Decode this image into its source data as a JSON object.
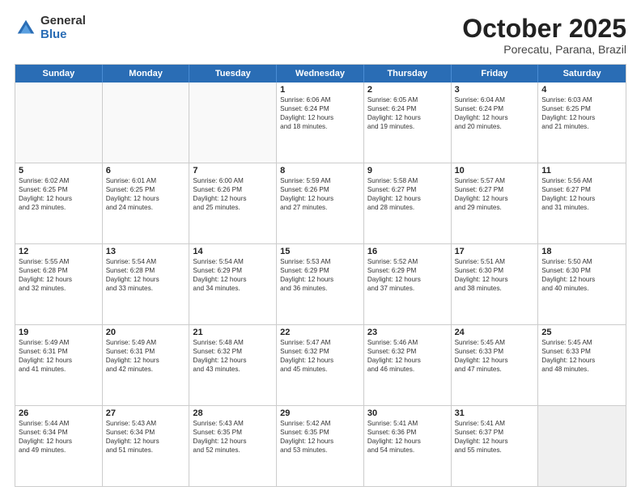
{
  "logo": {
    "general": "General",
    "blue": "Blue"
  },
  "header": {
    "month": "October 2025",
    "location": "Porecatu, Parana, Brazil"
  },
  "weekdays": [
    "Sunday",
    "Monday",
    "Tuesday",
    "Wednesday",
    "Thursday",
    "Friday",
    "Saturday"
  ],
  "rows": [
    [
      {
        "day": "",
        "text": "",
        "empty": true
      },
      {
        "day": "",
        "text": "",
        "empty": true
      },
      {
        "day": "",
        "text": "",
        "empty": true
      },
      {
        "day": "1",
        "text": "Sunrise: 6:06 AM\nSunset: 6:24 PM\nDaylight: 12 hours\nand 18 minutes."
      },
      {
        "day": "2",
        "text": "Sunrise: 6:05 AM\nSunset: 6:24 PM\nDaylight: 12 hours\nand 19 minutes."
      },
      {
        "day": "3",
        "text": "Sunrise: 6:04 AM\nSunset: 6:24 PM\nDaylight: 12 hours\nand 20 minutes."
      },
      {
        "day": "4",
        "text": "Sunrise: 6:03 AM\nSunset: 6:25 PM\nDaylight: 12 hours\nand 21 minutes."
      }
    ],
    [
      {
        "day": "5",
        "text": "Sunrise: 6:02 AM\nSunset: 6:25 PM\nDaylight: 12 hours\nand 23 minutes."
      },
      {
        "day": "6",
        "text": "Sunrise: 6:01 AM\nSunset: 6:25 PM\nDaylight: 12 hours\nand 24 minutes."
      },
      {
        "day": "7",
        "text": "Sunrise: 6:00 AM\nSunset: 6:26 PM\nDaylight: 12 hours\nand 25 minutes."
      },
      {
        "day": "8",
        "text": "Sunrise: 5:59 AM\nSunset: 6:26 PM\nDaylight: 12 hours\nand 27 minutes."
      },
      {
        "day": "9",
        "text": "Sunrise: 5:58 AM\nSunset: 6:27 PM\nDaylight: 12 hours\nand 28 minutes."
      },
      {
        "day": "10",
        "text": "Sunrise: 5:57 AM\nSunset: 6:27 PM\nDaylight: 12 hours\nand 29 minutes."
      },
      {
        "day": "11",
        "text": "Sunrise: 5:56 AM\nSunset: 6:27 PM\nDaylight: 12 hours\nand 31 minutes."
      }
    ],
    [
      {
        "day": "12",
        "text": "Sunrise: 5:55 AM\nSunset: 6:28 PM\nDaylight: 12 hours\nand 32 minutes."
      },
      {
        "day": "13",
        "text": "Sunrise: 5:54 AM\nSunset: 6:28 PM\nDaylight: 12 hours\nand 33 minutes."
      },
      {
        "day": "14",
        "text": "Sunrise: 5:54 AM\nSunset: 6:29 PM\nDaylight: 12 hours\nand 34 minutes."
      },
      {
        "day": "15",
        "text": "Sunrise: 5:53 AM\nSunset: 6:29 PM\nDaylight: 12 hours\nand 36 minutes."
      },
      {
        "day": "16",
        "text": "Sunrise: 5:52 AM\nSunset: 6:29 PM\nDaylight: 12 hours\nand 37 minutes."
      },
      {
        "day": "17",
        "text": "Sunrise: 5:51 AM\nSunset: 6:30 PM\nDaylight: 12 hours\nand 38 minutes."
      },
      {
        "day": "18",
        "text": "Sunrise: 5:50 AM\nSunset: 6:30 PM\nDaylight: 12 hours\nand 40 minutes."
      }
    ],
    [
      {
        "day": "19",
        "text": "Sunrise: 5:49 AM\nSunset: 6:31 PM\nDaylight: 12 hours\nand 41 minutes."
      },
      {
        "day": "20",
        "text": "Sunrise: 5:49 AM\nSunset: 6:31 PM\nDaylight: 12 hours\nand 42 minutes."
      },
      {
        "day": "21",
        "text": "Sunrise: 5:48 AM\nSunset: 6:32 PM\nDaylight: 12 hours\nand 43 minutes."
      },
      {
        "day": "22",
        "text": "Sunrise: 5:47 AM\nSunset: 6:32 PM\nDaylight: 12 hours\nand 45 minutes."
      },
      {
        "day": "23",
        "text": "Sunrise: 5:46 AM\nSunset: 6:32 PM\nDaylight: 12 hours\nand 46 minutes."
      },
      {
        "day": "24",
        "text": "Sunrise: 5:45 AM\nSunset: 6:33 PM\nDaylight: 12 hours\nand 47 minutes."
      },
      {
        "day": "25",
        "text": "Sunrise: 5:45 AM\nSunset: 6:33 PM\nDaylight: 12 hours\nand 48 minutes."
      }
    ],
    [
      {
        "day": "26",
        "text": "Sunrise: 5:44 AM\nSunset: 6:34 PM\nDaylight: 12 hours\nand 49 minutes."
      },
      {
        "day": "27",
        "text": "Sunrise: 5:43 AM\nSunset: 6:34 PM\nDaylight: 12 hours\nand 51 minutes."
      },
      {
        "day": "28",
        "text": "Sunrise: 5:43 AM\nSunset: 6:35 PM\nDaylight: 12 hours\nand 52 minutes."
      },
      {
        "day": "29",
        "text": "Sunrise: 5:42 AM\nSunset: 6:35 PM\nDaylight: 12 hours\nand 53 minutes."
      },
      {
        "day": "30",
        "text": "Sunrise: 5:41 AM\nSunset: 6:36 PM\nDaylight: 12 hours\nand 54 minutes."
      },
      {
        "day": "31",
        "text": "Sunrise: 5:41 AM\nSunset: 6:37 PM\nDaylight: 12 hours\nand 55 minutes."
      },
      {
        "day": "",
        "text": "",
        "empty": true,
        "shaded": true
      }
    ]
  ]
}
